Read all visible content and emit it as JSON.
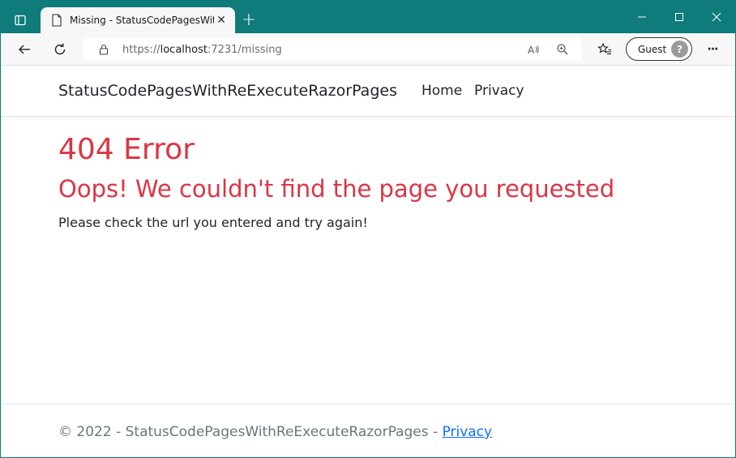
{
  "browser": {
    "tab_title": "Missing - StatusCodePagesWithReExecuteRazorPages",
    "tab_close": "✕",
    "new_tab": "+",
    "url_scheme": "https://",
    "url_host": "localhost",
    "url_path": ":7231/missing",
    "profile_label": "Guest",
    "profile_avatar_glyph": "?",
    "more_menu": "···",
    "icons": {
      "tab_actions": "tab-actions-icon",
      "favicon": "page-icon",
      "back": "back-arrow-icon",
      "refresh": "refresh-icon",
      "lock": "lock-icon",
      "read_aloud": "read-aloud-icon",
      "zoom": "zoom-icon",
      "favorites": "favorites-icon",
      "minimize": "minimize-icon",
      "maximize": "maximize-icon",
      "close": "close-icon"
    }
  },
  "site": {
    "brand": "StatusCodePagesWithReExecuteRazorPages",
    "nav": [
      "Home",
      "Privacy"
    ]
  },
  "content": {
    "title": "404 Error",
    "subtitle": "Oops! We couldn't find the page you requested",
    "message": "Please check the url you entered and try again!"
  },
  "footer": {
    "copyright": "© 2022 - StatusCodePagesWithReExecuteRazorPages - ",
    "privacy_link": "Privacy"
  },
  "colors": {
    "titlebar": "#0f7b7b",
    "error": "#dc3545",
    "link": "#0d6efd",
    "footer_text": "#6c757d"
  }
}
